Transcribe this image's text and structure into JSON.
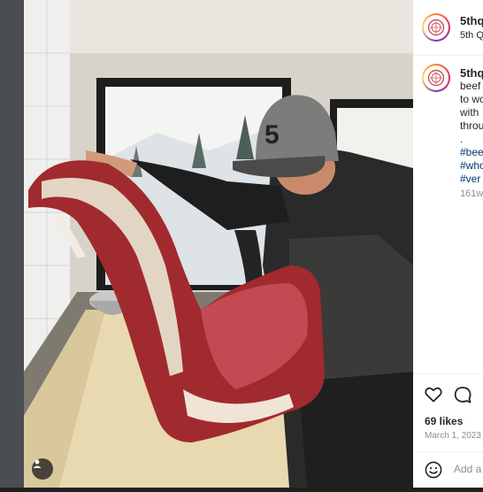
{
  "post": {
    "username": "5thq",
    "subtitle": "5th Q",
    "caption_lines": [
      "beef",
      "to wo",
      "with",
      "throu",
      "."
    ],
    "hashtags": [
      "#bee",
      "#who",
      "#ver"
    ],
    "caption_time": "161w",
    "likes": "69 likes",
    "date": "March 1, 2023",
    "comment_placeholder": "Add a"
  },
  "media": {
    "description_icon": "user-tag-icon"
  },
  "colors": {
    "link": "#00376b",
    "muted": "#8e8e8e",
    "text": "#262626",
    "cap_logo": "#222222"
  },
  "icons": [
    "heart-icon",
    "comment-icon",
    "emoji-icon",
    "avatar-logo-icon",
    "user-tag-icon"
  ]
}
